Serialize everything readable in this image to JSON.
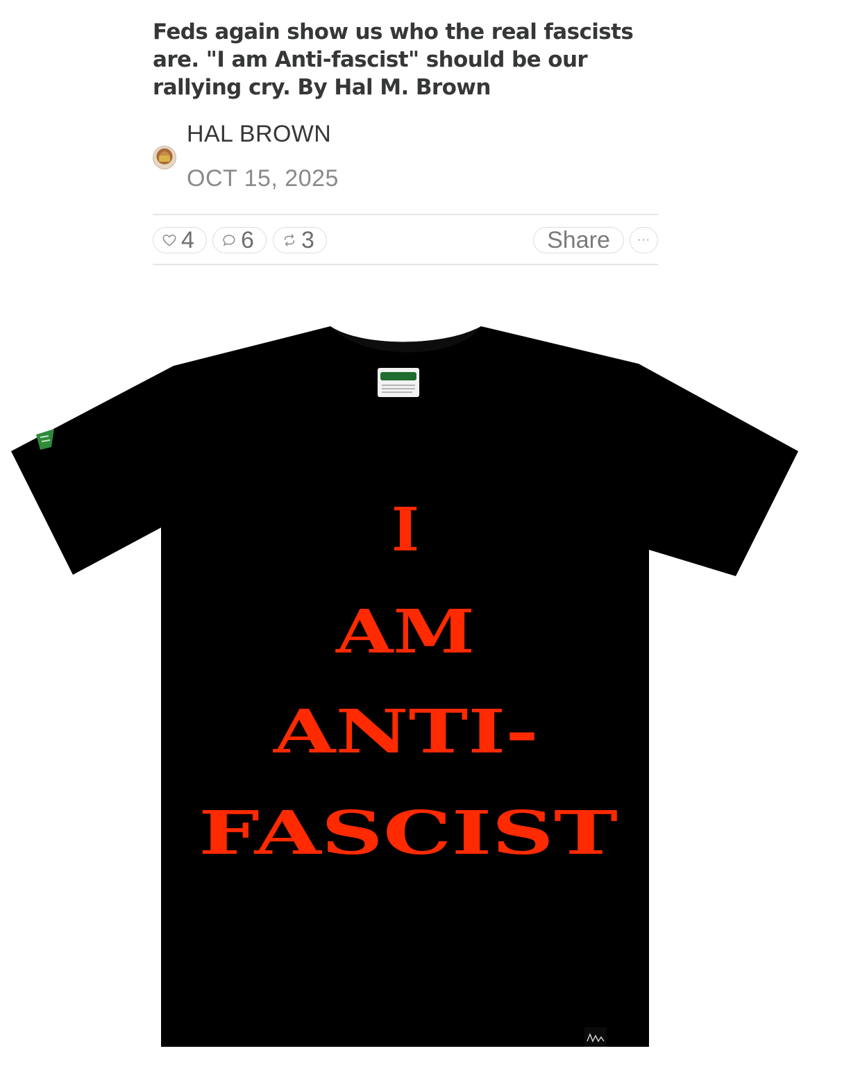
{
  "article": {
    "title": "Feds again show us who the real fascists are. \"I am Anti-fascist\" should be our rallying cry. By Hal M. Brown"
  },
  "byline": {
    "author": "HAL BROWN",
    "date": "OCT 15, 2025"
  },
  "actions": {
    "likes": "4",
    "comments": "6",
    "restacks": "3",
    "share_label": "Share",
    "more_label": "···"
  },
  "image": {
    "shirt_lines": [
      "I",
      "AM",
      "ANTI-",
      "FASCIST"
    ],
    "shirt_color": "#000000",
    "text_color": "#ff2a00"
  },
  "colors": {
    "title": "#363737",
    "muted": "#8a8a8a",
    "divider": "#e6e6e6"
  }
}
